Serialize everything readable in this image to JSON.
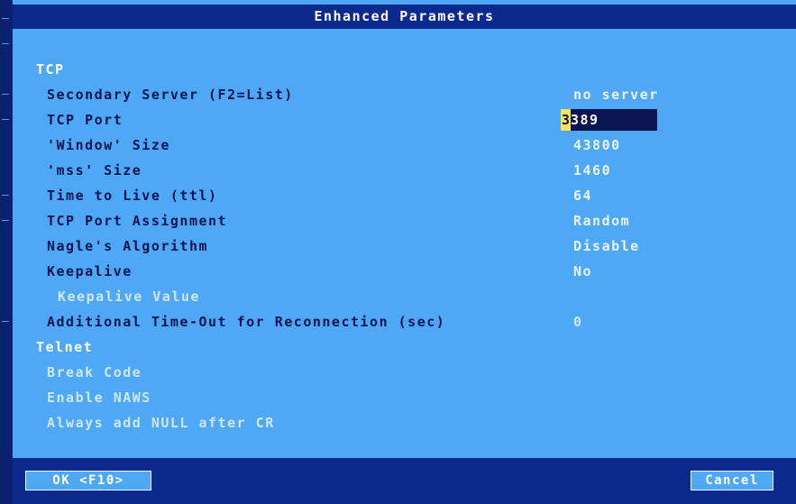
{
  "dialog": {
    "title": "Enhanced Parameters"
  },
  "sections": {
    "tcp": "TCP",
    "telnet": "Telnet"
  },
  "tcp": {
    "secondary_server": {
      "label": "Secondary Server (F2=List)",
      "value": "no server"
    },
    "tcp_port": {
      "label": "TCP Port",
      "value_cursor_char": "3",
      "value_rest": "389"
    },
    "window_size": {
      "label": "'Window' Size",
      "value": "43800"
    },
    "mss_size": {
      "label": "'mss' Size",
      "value": "1460"
    },
    "ttl": {
      "label": "Time to Live (ttl)",
      "value": "64"
    },
    "port_assignment": {
      "label": "TCP Port Assignment",
      "value": "Random"
    },
    "nagle": {
      "label": "Nagle's Algorithm",
      "value": "Disable"
    },
    "keepalive": {
      "label": "Keepalive",
      "value": "No"
    },
    "keepalive_value": {
      "label": "Keepalive Value"
    },
    "reconnect_timeout": {
      "label": "Additional Time-Out for Reconnection (sec)",
      "value": "0"
    }
  },
  "telnet": {
    "break_code": {
      "label": "Break Code"
    },
    "enable_naws": {
      "label": "Enable NAWS"
    },
    "null_after_cr": {
      "label": "Always add NULL after CR"
    }
  },
  "buttons": {
    "ok": "OK <F10>",
    "cancel": "Cancel"
  },
  "colors": {
    "background": "#4fa8f5",
    "bars": "#0c2a8e",
    "label_text": "#0a1450",
    "cursor": "#f5e35a"
  }
}
